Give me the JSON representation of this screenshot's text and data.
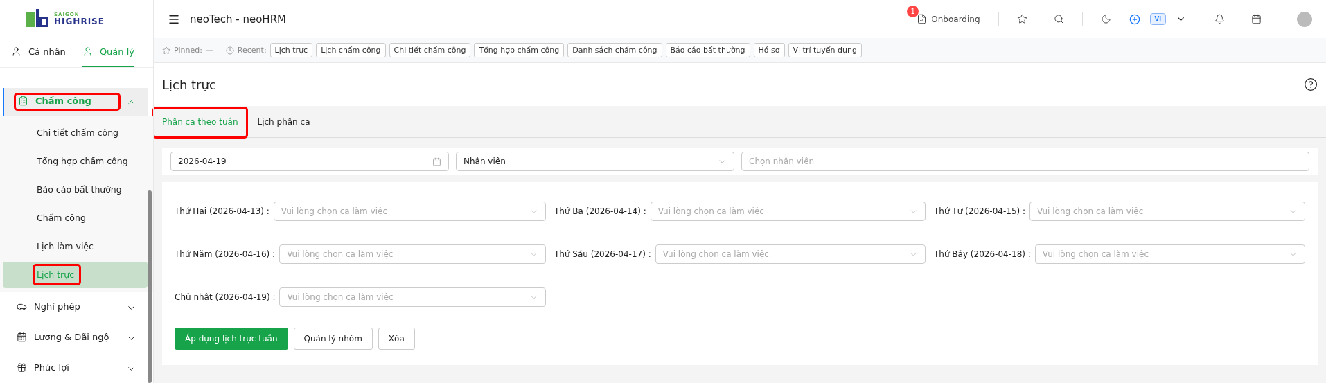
{
  "sidebar": {
    "logo": {
      "small": "SAIGON",
      "big": "HIGHRISE"
    },
    "modes": [
      {
        "label": "Cá nhân",
        "selected": false
      },
      {
        "label": "Quản lý",
        "selected": true
      }
    ],
    "menu": [
      {
        "label": "Chấm công",
        "expanded": true,
        "highlighted": true,
        "children": [
          {
            "label": "Chi tiết chấm công",
            "selected": false,
            "highlighted": false
          },
          {
            "label": "Tổng hợp chấm công",
            "selected": false,
            "highlighted": false
          },
          {
            "label": "Báo cáo bất thường",
            "selected": false,
            "highlighted": false
          },
          {
            "label": "Chấm công",
            "selected": false,
            "highlighted": false
          },
          {
            "label": "Lịch làm việc",
            "selected": false,
            "highlighted": false
          },
          {
            "label": "Lịch trực",
            "selected": true,
            "highlighted": true
          }
        ]
      },
      {
        "label": "Nghỉ phép",
        "expanded": false,
        "highlighted": false
      },
      {
        "label": "Lương & Đãi ngộ",
        "expanded": false,
        "highlighted": false
      },
      {
        "label": "Phúc lợi",
        "expanded": false,
        "highlighted": false
      }
    ]
  },
  "header": {
    "title": "neoTech - neoHRM",
    "onboarding": {
      "label": "Onboarding",
      "badge": "1"
    },
    "language": "VI"
  },
  "pinned_bar": {
    "pinned_label": "Pinned:",
    "recent_label": "Recent:",
    "recent": [
      "Lịch trực",
      "Lịch chấm công",
      "Chi tiết chấm công",
      "Tổng hợp chấm công",
      "Danh sách chấm công",
      "Báo cáo bất thường",
      "Hồ sơ",
      "Vị trí tuyển dụng"
    ]
  },
  "page": {
    "title": "Lịch trực",
    "tabs": [
      {
        "label": "Phân ca theo tuần",
        "selected": true,
        "highlighted": true
      },
      {
        "label": "Lịch phân ca",
        "selected": false,
        "highlighted": false
      }
    ],
    "filters": {
      "date": "2026-04-19",
      "type": "Nhân viên",
      "employee_placeholder": "Chọn nhân viên"
    },
    "days": [
      {
        "label": "Thứ Hai (2026-04-13) :",
        "placeholder": "Vui lòng chọn ca làm việc"
      },
      {
        "label": "Thứ Ba (2026-04-14) :",
        "placeholder": "Vui lòng chọn ca làm việc"
      },
      {
        "label": "Thứ Tư (2026-04-15) :",
        "placeholder": "Vui lòng chọn ca làm việc"
      },
      {
        "label": "Thứ Năm (2026-04-16) :",
        "placeholder": "Vui lòng chọn ca làm việc"
      },
      {
        "label": "Thứ Sáu (2026-04-17) :",
        "placeholder": "Vui lòng chọn ca làm việc"
      },
      {
        "label": "Thứ Bảy (2026-04-18) :",
        "placeholder": "Vui lòng chọn ca làm việc"
      },
      {
        "label": "Chủ nhật (2026-04-19) :",
        "placeholder": "Vui lòng chọn ca làm việc"
      }
    ],
    "buttons": [
      {
        "label": "Áp dụng lịch trực tuần",
        "kind": "primary"
      },
      {
        "label": "Quản lý nhóm",
        "kind": "default"
      },
      {
        "label": "Xóa",
        "kind": "default"
      }
    ]
  }
}
